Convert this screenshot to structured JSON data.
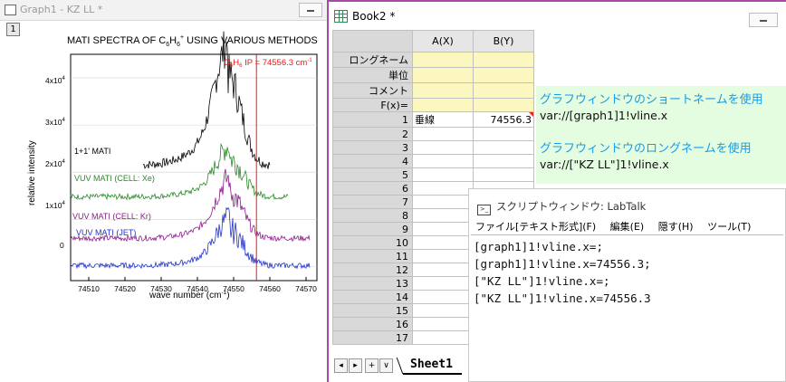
{
  "graph_window": {
    "title": "Graph1 - KZ LL *",
    "layer": "1",
    "chart_title": "MATI SPECTRA OF C",
    "chart_title_sub": "6",
    "chart_title_mid": "H",
    "chart_title_sub2": "6",
    "chart_title_sup": "+",
    "chart_title_tail": " USING VARIOUS METHODS",
    "ip_label": "C",
    "ip_label_sub": "6",
    "ip_label_mid": "H",
    "ip_label_sub2": "6",
    "ip_label_tail": " IP = 74556.3 cm",
    "ip_label_sup": "-1",
    "ylabel": "relative intensity",
    "xlabel": "wave number (cm",
    "xlabel_sup": "-1",
    "xlabel_tail": ")",
    "ytick_4": "4x10",
    "ytick_3": "3x10",
    "ytick_2": "2x10",
    "ytick_1": "1x10",
    "ytick_exp": "4",
    "ytick_0": "0"
  },
  "chart_data": {
    "type": "line",
    "title": "MATI SPECTRA OF C6H6+ USING VARIOUS METHODS",
    "xlabel": "wave number (cm-1)",
    "ylabel": "relative intensity",
    "x_ticks": [
      74510,
      74520,
      74530,
      74540,
      74550,
      74560,
      74570
    ],
    "y_ticks": [
      "0",
      "1x10^4",
      "2x10^4",
      "3x10^4",
      "4x10^4"
    ],
    "xlim": [
      74505,
      74573
    ],
    "ylim": [
      -0.3,
      4.5
    ],
    "vline": {
      "x": 74556.3,
      "label": "C6H6+ IP = 74556.3 cm-1",
      "color": "#e02020"
    },
    "series": [
      {
        "name": "1+1' MATI",
        "color": "#000000",
        "baseline": 2.15,
        "x_start": 74525,
        "x_end": 74560,
        "peak_x": 74548.5,
        "peak_height": 1.9,
        "width": 5
      },
      {
        "name": "VUV MATI (CELL: Xe)",
        "color": "#2a8a2a",
        "baseline": 1.48,
        "x_start": 74505,
        "x_end": 74565,
        "peak_x": 74549,
        "peak_height": 0.8,
        "width": 5
      },
      {
        "name": "VUV MATI (CELL: Kr)",
        "color": "#8c1a8c",
        "baseline": 0.6,
        "x_start": 74505,
        "x_end": 74571,
        "peak_x": 74549,
        "peak_height": 0.95,
        "width": 5
      },
      {
        "name": "VUV MATI (JET)",
        "color": "#2233cc",
        "baseline": 0.02,
        "x_start": 74505,
        "x_end": 74571,
        "peak_x": 74549,
        "peak_height": 0.75,
        "width": 5
      }
    ]
  },
  "book_window": {
    "title": "Book2 *",
    "columns": [
      "A(X)",
      "B(Y)"
    ],
    "header_rows": [
      "ロングネーム",
      "単位",
      "コメント",
      "F(x)="
    ],
    "row_numbers": [
      "1",
      "2",
      "3",
      "4",
      "5",
      "6",
      "7",
      "8",
      "9",
      "10",
      "11",
      "12",
      "13",
      "14",
      "15",
      "16",
      "17"
    ],
    "row1_a": "垂線",
    "row1_b": "74556.3",
    "note_heading_1": "グラフウィンドウのショートネームを使用",
    "note_code_1": "var://[graph1]1!vline.x",
    "note_heading_2": "グラフウィンドウのロングネームを使用",
    "note_code_2": "var://[\"KZ LL\"]1!vline.x",
    "sheet_tab": "Sheet1"
  },
  "script_window": {
    "title": "スクリプトウィンドウ: LabTalk",
    "menu": [
      "ファイル[テキスト形式](F)",
      "編集(E)",
      "隠す(H)",
      "ツール(T)"
    ],
    "lines": [
      "[graph1]1!vline.x=;",
      "[graph1]1!vline.x=74556.3;",
      "[\"KZ LL\"]1!vline.x=;",
      "[\"KZ LL\"]1!vline.x=74556.3"
    ]
  }
}
